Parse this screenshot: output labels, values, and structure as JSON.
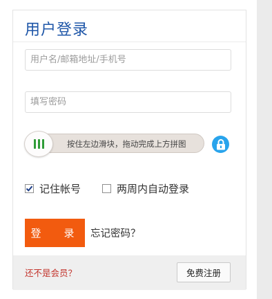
{
  "login": {
    "title": "用户登录",
    "username": {
      "value": "",
      "placeholder": "用户名/邮箱地址/手机号"
    },
    "password": {
      "value": "",
      "placeholder": "填写密码"
    },
    "captcha": {
      "slider_text": "按住左边滑块，拖动完成上方拼图",
      "handle_icon": "grip-icon",
      "lock_icon": "lock-icon"
    },
    "remember_account": {
      "label": "记住帐号",
      "checked": true
    },
    "auto_login": {
      "label": "两周内自动登录",
      "checked": false
    },
    "login_button": "登　录",
    "forgot_password": "忘记密码？",
    "footer": {
      "not_member": "还不是会员？",
      "register_button": "免费注册"
    }
  },
  "colors": {
    "title": "#1e56a8",
    "accent": "#f25b0f",
    "link_red": "#c3352d",
    "lock": "#29a4ec"
  }
}
